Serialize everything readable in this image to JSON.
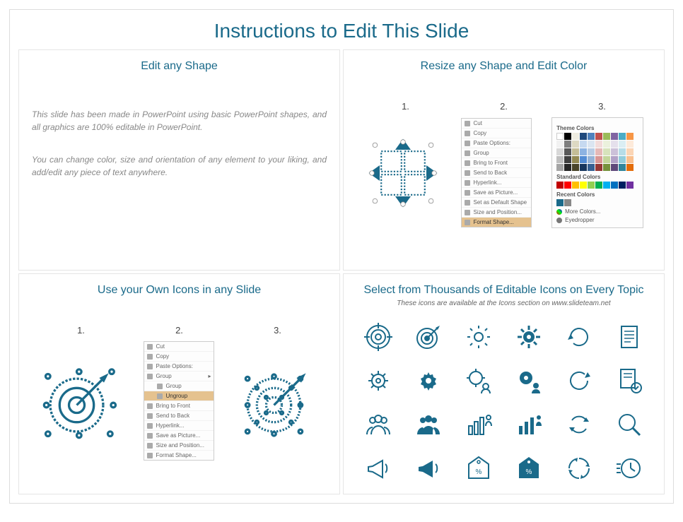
{
  "title": "Instructions to Edit This Slide",
  "panels": {
    "p1": {
      "title": "Edit any Shape",
      "para1": "This slide has been made in PowerPoint using basic PowerPoint shapes, and all graphics are 100% editable in PowerPoint.",
      "para2": "You can change color, size and orientation of any element to your liking, and add/edit any piece of text anywhere."
    },
    "p2": {
      "title": "Resize any Shape and Edit Color",
      "steps": [
        "1.",
        "2.",
        "3."
      ],
      "menu": {
        "items": [
          "Cut",
          "Copy",
          "Paste Options:",
          "Group",
          "Bring to Front",
          "Send to Back",
          "Hyperlink...",
          "Save as Picture...",
          "Set as Default Shape",
          "Size and Position...",
          "Format Shape..."
        ],
        "highlight": "Format Shape..."
      },
      "palette": {
        "section1": "Theme Colors",
        "section2": "Standard Colors",
        "section3": "Recent Colors",
        "more": "More Colors...",
        "eyedrop": "Eyedropper"
      }
    },
    "p3": {
      "title": "Use your Own Icons in any Slide",
      "steps": [
        "1.",
        "2.",
        "3."
      ],
      "menu": {
        "items": [
          "Cut",
          "Copy",
          "Paste Options:",
          "Group",
          "Ungroup",
          "Bring to Front",
          "Send to Back",
          "Hyperlink...",
          "Save as Picture...",
          "Size and Position...",
          "Format Shape..."
        ],
        "group_label": "Group",
        "highlight": "Ungroup"
      }
    },
    "p4": {
      "title": "Select from Thousands of Editable Icons on Every Topic",
      "sub": "These icons are available at the Icons section on www.slideteam.net",
      "icons": [
        "target-icon",
        "dart-target-icon",
        "gear-icon",
        "gear-filled-icon",
        "refresh-icon",
        "document-icon",
        "cog-icon",
        "cog-solid-icon",
        "gear-user-icon",
        "gear-user-solid-icon",
        "reload-icon",
        "doc-check-icon",
        "people-icon",
        "people-solid-icon",
        "bars-people-icon",
        "bars-people-solid-icon",
        "cycle-icon",
        "magnifier-icon",
        "megaphone-icon",
        "megaphone-solid-icon",
        "percent-tag-icon",
        "percent-tag-solid-icon",
        "arrows-cycle-icon",
        "clock-speed-icon"
      ]
    }
  },
  "colors": {
    "accent": "#1a6a8a"
  }
}
